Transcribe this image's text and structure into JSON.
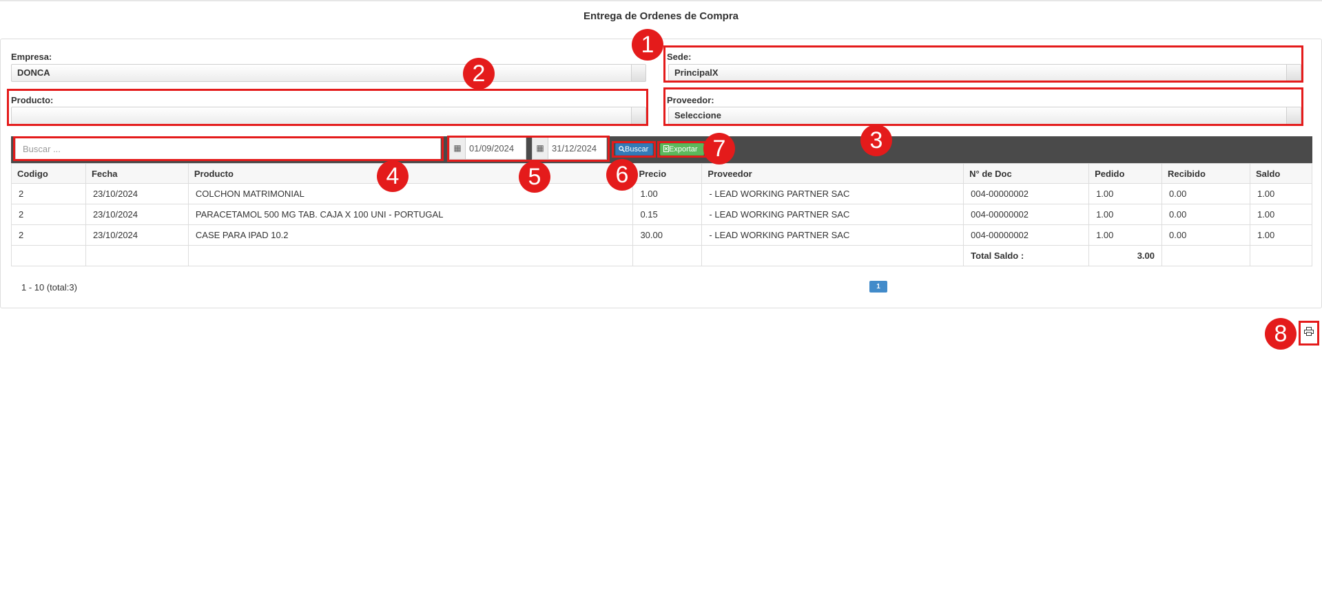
{
  "page": {
    "title": "Entrega de Ordenes de Compra"
  },
  "filters": {
    "empresa_label": "Empresa:",
    "empresa_value": "DONCA",
    "sede_label": "Sede:",
    "sede_value": "PrincipalX",
    "producto_label": "Producto:",
    "producto_value": "",
    "proveedor_label": "Proveedor:",
    "proveedor_value": "Seleccione"
  },
  "toolbar": {
    "search_placeholder": "Buscar ...",
    "date_from": "01/09/2024",
    "date_to": "31/12/2024",
    "buscar_label": "Buscar",
    "exportar_label": "Exportar"
  },
  "table": {
    "headers": [
      "Codigo",
      "Fecha",
      "Producto",
      "Precio",
      "Proveedor",
      "N° de Doc",
      "Pedido",
      "Recibido",
      "Saldo"
    ],
    "rows": [
      [
        "2",
        "23/10/2024",
        "COLCHON MATRIMONIAL",
        "1.00",
        "- LEAD WORKING PARTNER SAC",
        "004-00000002",
        "1.00",
        "0.00",
        "1.00"
      ],
      [
        "2",
        "23/10/2024",
        "PARACETAMOL 500 MG TAB. CAJA X 100 UNI - PORTUGAL",
        "0.15",
        "- LEAD WORKING PARTNER SAC",
        "004-00000002",
        "1.00",
        "0.00",
        "1.00"
      ],
      [
        "2",
        "23/10/2024",
        "CASE PARA IPAD 10.2",
        "30.00",
        "- LEAD WORKING PARTNER SAC",
        "004-00000002",
        "1.00",
        "0.00",
        "1.00"
      ]
    ],
    "total_label": "Total Saldo :",
    "total_value": "3.00"
  },
  "pagination": {
    "info": "1 - 10 (total:3)",
    "current_page": "1"
  },
  "annotations": [
    "1",
    "2",
    "3",
    "4",
    "5",
    "6",
    "7",
    "8"
  ],
  "colors": {
    "annotation_red": "#e41b1b",
    "toolbar_bg": "#4a4a4a",
    "buscar_blue": "#337ab7",
    "exportar_green": "#5cb85c",
    "page_blue": "#428bca"
  },
  "icons": {
    "calendar": "calendar-icon",
    "search": "search-icon",
    "excel": "excel-icon",
    "print": "print-icon"
  }
}
